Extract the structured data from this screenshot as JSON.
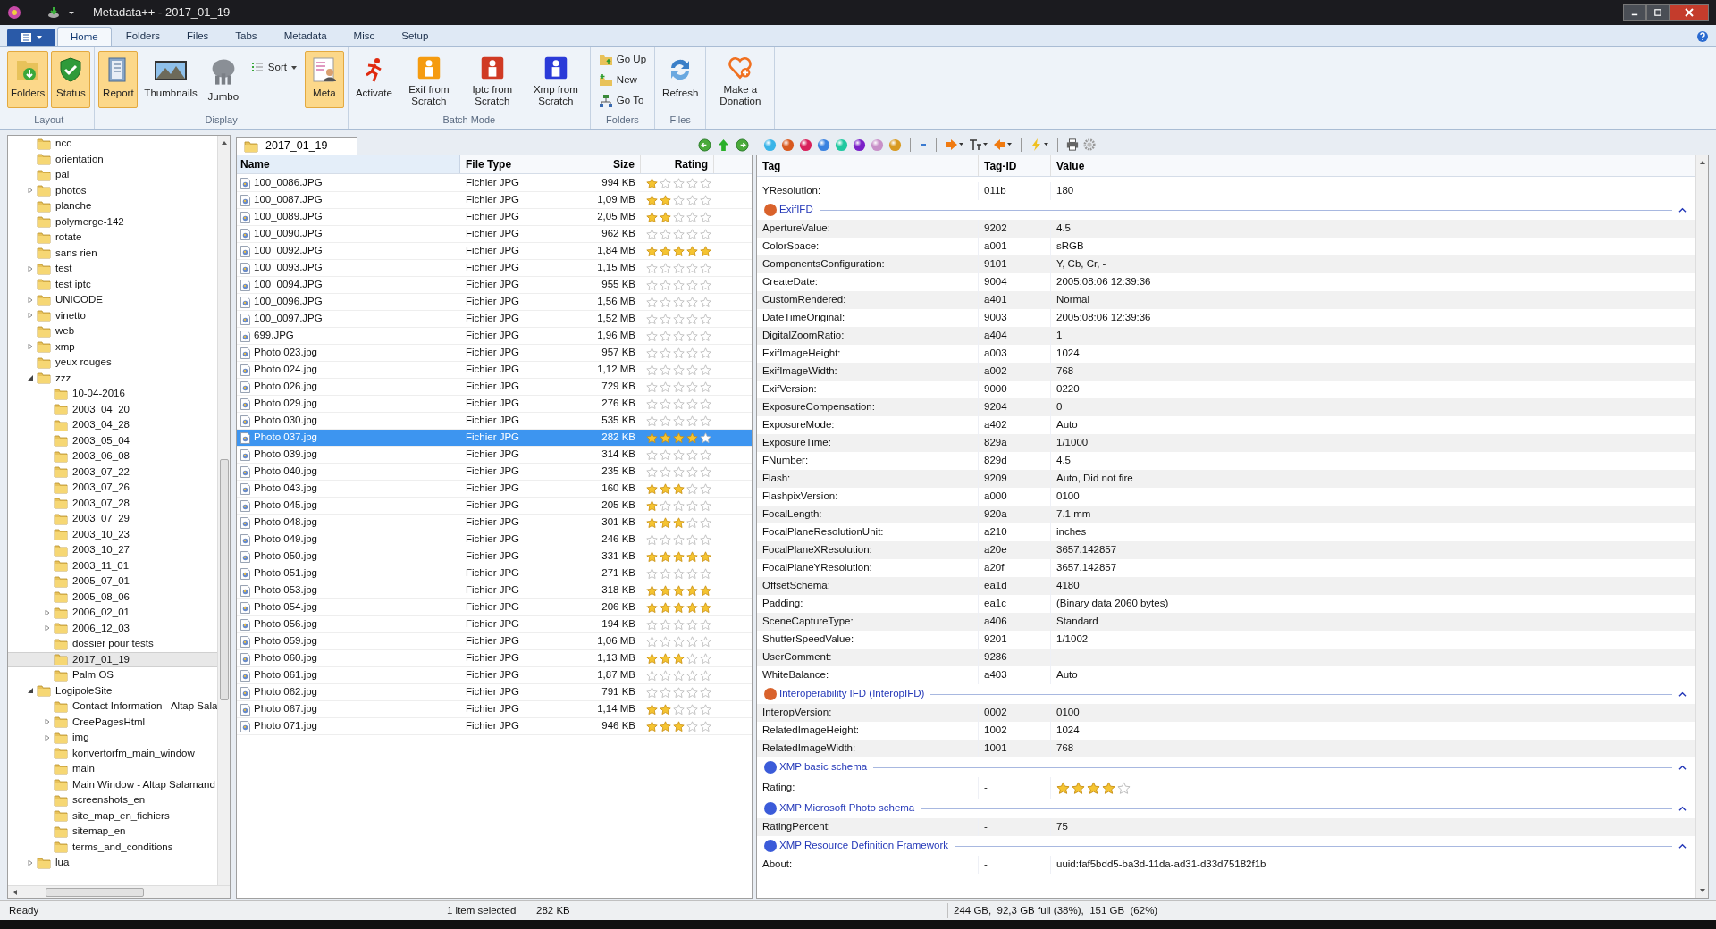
{
  "window": {
    "title": "Metadata++ - 2017_01_19"
  },
  "ribbon_tabs": [
    {
      "label": "Home",
      "selected": true
    },
    {
      "label": "Folders",
      "selected": false
    },
    {
      "label": "Files",
      "selected": false
    },
    {
      "label": "Tabs",
      "selected": false
    },
    {
      "label": "Metadata",
      "selected": false
    },
    {
      "label": "Misc",
      "selected": false
    },
    {
      "label": "Setup",
      "selected": false
    }
  ],
  "ribbon_groups": [
    {
      "label": "Layout",
      "buttons": [
        {
          "kind": "large",
          "label": "Folders",
          "on": true
        },
        {
          "kind": "large",
          "label": "Status",
          "on": true
        }
      ]
    },
    {
      "label": "Display",
      "buttons": [
        {
          "kind": "large",
          "label": "Report",
          "on": true
        },
        {
          "kind": "large",
          "label": "Thumbnails",
          "on": false
        },
        {
          "kind": "large",
          "label": "Jumbo",
          "on": false
        },
        {
          "kind": "menu",
          "label": "Sort",
          "on": false
        },
        {
          "kind": "large",
          "label": "Meta",
          "on": true
        }
      ]
    },
    {
      "label": "Batch Mode",
      "buttons": [
        {
          "kind": "large",
          "label": "Activate",
          "on": false
        },
        {
          "kind": "large",
          "label": "Exif from Scratch",
          "on": false
        },
        {
          "kind": "large",
          "label": "Iptc from Scratch",
          "on": false
        },
        {
          "kind": "large",
          "label": "Xmp from Scratch",
          "on": false
        }
      ]
    },
    {
      "label": "Folders",
      "buttons": [
        {
          "kind": "small",
          "label": "Go Up",
          "on": false
        },
        {
          "kind": "small",
          "label": "New",
          "on": false
        },
        {
          "kind": "small",
          "label": "Go To",
          "on": false
        }
      ]
    },
    {
      "label": "Files",
      "buttons": [
        {
          "kind": "large",
          "label": "Refresh",
          "on": false
        }
      ]
    },
    {
      "buttons": [
        {
          "kind": "large",
          "label": "Make a Donation",
          "on": false
        }
      ]
    }
  ],
  "tree": [
    {
      "children": [
        {
          "label": "ncc",
          "selected": false
        },
        {
          "label": "orientation",
          "selected": false
        },
        {
          "label": "pal",
          "selected": false
        },
        {
          "label": "photos",
          "expanded": false,
          "selected": false
        },
        {
          "label": "planche",
          "selected": false
        },
        {
          "label": "polymerge-142",
          "selected": false
        },
        {
          "label": "rotate",
          "selected": false
        },
        {
          "label": "sans rien",
          "selected": false
        },
        {
          "label": "test",
          "expanded": false,
          "selected": false
        },
        {
          "label": "test iptc",
          "selected": false
        },
        {
          "label": "UNICODE",
          "expanded": false,
          "selected": false
        },
        {
          "label": "vinetto",
          "expanded": false,
          "selected": false
        },
        {
          "label": "web",
          "selected": false
        },
        {
          "label": "xmp",
          "expanded": false,
          "selected": false
        },
        {
          "label": "yeux rouges",
          "selected": false
        },
        {
          "label": "zzz",
          "expanded": true,
          "selected": false,
          "children": [
            {
              "label": "10-04-2016",
              "selected": false
            },
            {
              "label": "2003_04_20",
              "selected": false
            },
            {
              "label": "2003_04_28",
              "selected": false
            },
            {
              "label": "2003_05_04",
              "selected": false
            },
            {
              "label": "2003_06_08",
              "selected": false
            },
            {
              "label": "2003_07_22",
              "selected": false
            },
            {
              "label": "2003_07_26",
              "selected": false
            },
            {
              "label": "2003_07_28",
              "selected": false
            },
            {
              "label": "2003_07_29",
              "selected": false
            },
            {
              "label": "2003_10_23",
              "selected": false
            },
            {
              "label": "2003_10_27",
              "selected": false
            },
            {
              "label": "2003_11_01",
              "selected": false
            },
            {
              "label": "2005_07_01",
              "selected": false
            },
            {
              "label": "2005_08_06",
              "selected": false
            },
            {
              "label": "2006_02_01",
              "expanded": false,
              "selected": false
            },
            {
              "label": "2006_12_03",
              "expanded": false,
              "selected": false
            },
            {
              "label": "dossier pour tests",
              "selected": false
            },
            {
              "label": "2017_01_19",
              "selected": true
            },
            {
              "label": "Palm OS",
              "selected": false
            }
          ]
        }
      ]
    },
    {
      "label": "LogipoleSite",
      "expanded": true,
      "selected": false,
      "children": [
        {
          "label": "Contact Information - Altap Sala",
          "selected": false
        },
        {
          "label": "CreePagesHtml",
          "expanded": false,
          "selected": false
        },
        {
          "label": "img",
          "expanded": false,
          "selected": false
        },
        {
          "label": "konvertorfm_main_window",
          "selected": false
        },
        {
          "label": "main",
          "selected": false
        },
        {
          "label": "Main Window - Altap Salamand",
          "selected": false
        },
        {
          "label": "screenshots_en",
          "selected": false
        },
        {
          "label": "site_map_en_fichiers",
          "selected": false
        },
        {
          "label": "sitemap_en",
          "selected": false
        },
        {
          "label": "terms_and_conditions",
          "selected": false
        }
      ]
    },
    {
      "label": "lua",
      "expanded": false,
      "selected": false
    }
  ],
  "file_tab": {
    "label": "2017_01_19"
  },
  "file_columns": [
    "Name",
    "File Type",
    "Size",
    "Rating"
  ],
  "files": [
    {
      "name": "100_0086.JPG",
      "type": "Fichier JPG",
      "size": "994 KB",
      "stars": 1,
      "selected": false
    },
    {
      "name": "100_0087.JPG",
      "type": "Fichier JPG",
      "size": "1,09 MB",
      "stars": 2,
      "selected": false
    },
    {
      "name": "100_0089.JPG",
      "type": "Fichier JPG",
      "size": "2,05 MB",
      "stars": 2,
      "selected": false
    },
    {
      "name": "100_0090.JPG",
      "type": "Fichier JPG",
      "size": "962 KB",
      "stars": 0,
      "selected": false
    },
    {
      "name": "100_0092.JPG",
      "type": "Fichier JPG",
      "size": "1,84 MB",
      "stars": 5,
      "selected": false
    },
    {
      "name": "100_0093.JPG",
      "type": "Fichier JPG",
      "size": "1,15 MB",
      "stars": 0,
      "selected": false
    },
    {
      "name": "100_0094.JPG",
      "type": "Fichier JPG",
      "size": "955 KB",
      "stars": 0,
      "selected": false
    },
    {
      "name": "100_0096.JPG",
      "type": "Fichier JPG",
      "size": "1,56 MB",
      "stars": 0,
      "selected": false
    },
    {
      "name": "100_0097.JPG",
      "type": "Fichier JPG",
      "size": "1,52 MB",
      "stars": 0,
      "selected": false
    },
    {
      "name": "699.JPG",
      "type": "Fichier JPG",
      "size": "1,96 MB",
      "stars": 0,
      "selected": false
    },
    {
      "name": "Photo 023.jpg",
      "type": "Fichier JPG",
      "size": "957 KB",
      "stars": 0,
      "selected": false
    },
    {
      "name": "Photo 024.jpg",
      "type": "Fichier JPG",
      "size": "1,12 MB",
      "stars": 0,
      "selected": false
    },
    {
      "name": "Photo 026.jpg",
      "type": "Fichier JPG",
      "size": "729 KB",
      "stars": 0,
      "selected": false
    },
    {
      "name": "Photo 029.jpg",
      "type": "Fichier JPG",
      "size": "276 KB",
      "stars": 0,
      "selected": false
    },
    {
      "name": "Photo 030.jpg",
      "type": "Fichier JPG",
      "size": "535 KB",
      "stars": 0,
      "selected": false
    },
    {
      "name": "Photo 037.jpg",
      "type": "Fichier JPG",
      "size": "282 KB",
      "stars": 4,
      "selected": true
    },
    {
      "name": "Photo 039.jpg",
      "type": "Fichier JPG",
      "size": "314 KB",
      "stars": 0,
      "selected": false
    },
    {
      "name": "Photo 040.jpg",
      "type": "Fichier JPG",
      "size": "235 KB",
      "stars": 0,
      "selected": false
    },
    {
      "name": "Photo 043.jpg",
      "type": "Fichier JPG",
      "size": "160 KB",
      "stars": 3,
      "selected": false
    },
    {
      "name": "Photo 045.jpg",
      "type": "Fichier JPG",
      "size": "205 KB",
      "stars": 1,
      "selected": false
    },
    {
      "name": "Photo 048.jpg",
      "type": "Fichier JPG",
      "size": "301 KB",
      "stars": 3,
      "selected": false
    },
    {
      "name": "Photo 049.jpg",
      "type": "Fichier JPG",
      "size": "246 KB",
      "stars": 0,
      "selected": false
    },
    {
      "name": "Photo 050.jpg",
      "type": "Fichier JPG",
      "size": "331 KB",
      "stars": 5,
      "selected": false
    },
    {
      "name": "Photo 051.jpg",
      "type": "Fichier JPG",
      "size": "271 KB",
      "stars": 0,
      "selected": false
    },
    {
      "name": "Photo 053.jpg",
      "type": "Fichier JPG",
      "size": "318 KB",
      "stars": 5,
      "selected": false
    },
    {
      "name": "Photo 054.jpg",
      "type": "Fichier JPG",
      "size": "206 KB",
      "stars": 5,
      "selected": false
    },
    {
      "name": "Photo 056.jpg",
      "type": "Fichier JPG",
      "size": "194 KB",
      "stars": 0,
      "selected": false
    },
    {
      "name": "Photo 059.jpg",
      "type": "Fichier JPG",
      "size": "1,06 MB",
      "stars": 0,
      "selected": false
    },
    {
      "name": "Photo 060.jpg",
      "type": "Fichier JPG",
      "size": "1,13 MB",
      "stars": 3,
      "selected": false
    },
    {
      "name": "Photo 061.jpg",
      "type": "Fichier JPG",
      "size": "1,87 MB",
      "stars": 0,
      "selected": false
    },
    {
      "name": "Photo 062.jpg",
      "type": "Fichier JPG",
      "size": "791 KB",
      "stars": 0,
      "selected": false
    },
    {
      "name": "Photo 067.jpg",
      "type": "Fichier JPG",
      "size": "1,14 MB",
      "stars": 2,
      "selected": false
    },
    {
      "name": "Photo 071.jpg",
      "type": "Fichier JPG",
      "size": "946 KB",
      "stars": 3,
      "selected": false
    }
  ],
  "meta_columns": [
    "Tag",
    "Tag-ID",
    "Value"
  ],
  "meta_rows": [
    {
      "kind": "field",
      "tag": "YResolution:",
      "id": "011b",
      "value": "180"
    },
    {
      "kind": "section",
      "title": "ExifIFD",
      "color": "#d9622b",
      "expanded": true
    },
    {
      "kind": "field",
      "tag": "ApertureValue:",
      "id": "9202",
      "value": "4.5"
    },
    {
      "kind": "field",
      "tag": "ColorSpace:",
      "id": "a001",
      "value": "sRGB"
    },
    {
      "kind": "field",
      "tag": "ComponentsConfiguration:",
      "id": "9101",
      "value": "Y, Cb, Cr, -"
    },
    {
      "kind": "field",
      "tag": "CreateDate:",
      "id": "9004",
      "value": "2005:08:06 12:39:36"
    },
    {
      "kind": "field",
      "tag": "CustomRendered:",
      "id": "a401",
      "value": "Normal"
    },
    {
      "kind": "field",
      "tag": "DateTimeOriginal:",
      "id": "9003",
      "value": "2005:08:06 12:39:36"
    },
    {
      "kind": "field",
      "tag": "DigitalZoomRatio:",
      "id": "a404",
      "value": "1"
    },
    {
      "kind": "field",
      "tag": "ExifImageHeight:",
      "id": "a003",
      "value": "1024"
    },
    {
      "kind": "field",
      "tag": "ExifImageWidth:",
      "id": "a002",
      "value": "768"
    },
    {
      "kind": "field",
      "tag": "ExifVersion:",
      "id": "9000",
      "value": "0220"
    },
    {
      "kind": "field",
      "tag": "ExposureCompensation:",
      "id": "9204",
      "value": "0"
    },
    {
      "kind": "field",
      "tag": "ExposureMode:",
      "id": "a402",
      "value": "Auto"
    },
    {
      "kind": "field",
      "tag": "ExposureTime:",
      "id": "829a",
      "value": "1/1000"
    },
    {
      "kind": "field",
      "tag": "FNumber:",
      "id": "829d",
      "value": "4.5"
    },
    {
      "kind": "field",
      "tag": "Flash:",
      "id": "9209",
      "value": "Auto, Did not fire"
    },
    {
      "kind": "field",
      "tag": "FlashpixVersion:",
      "id": "a000",
      "value": "0100"
    },
    {
      "kind": "field",
      "tag": "FocalLength:",
      "id": "920a",
      "value": "7.1 mm"
    },
    {
      "kind": "field",
      "tag": "FocalPlaneResolutionUnit:",
      "id": "a210",
      "value": "inches"
    },
    {
      "kind": "field",
      "tag": "FocalPlaneXResolution:",
      "id": "a20e",
      "value": "3657.142857"
    },
    {
      "kind": "field",
      "tag": "FocalPlaneYResolution:",
      "id": "a20f",
      "value": "3657.142857"
    },
    {
      "kind": "field",
      "tag": "OffsetSchema:",
      "id": "ea1d",
      "value": "4180"
    },
    {
      "kind": "field",
      "tag": "Padding:",
      "id": "ea1c",
      "value": "(Binary data 2060 bytes)"
    },
    {
      "kind": "field",
      "tag": "SceneCaptureType:",
      "id": "a406",
      "value": "Standard"
    },
    {
      "kind": "field",
      "tag": "ShutterSpeedValue:",
      "id": "9201",
      "value": "1/1002"
    },
    {
      "kind": "field",
      "tag": "UserComment:",
      "id": "9286"
    },
    {
      "kind": "field",
      "tag": "WhiteBalance:",
      "id": "a403",
      "value": "Auto"
    },
    {
      "kind": "section",
      "title": "Interoperability IFD (InteropIFD)",
      "color": "#d9622b",
      "expanded": true
    },
    {
      "kind": "field",
      "tag": "InteropVersion:",
      "id": "0002",
      "value": "0100"
    },
    {
      "kind": "field",
      "tag": "RelatedImageHeight:",
      "id": "1002",
      "value": "1024"
    },
    {
      "kind": "field",
      "tag": "RelatedImageWidth:",
      "id": "1001",
      "value": "768"
    },
    {
      "kind": "section",
      "title": "XMP basic schema",
      "color": "#3b5bd9",
      "expanded": true
    },
    {
      "kind": "rating",
      "tag": "Rating:",
      "id": "-",
      "stars": 4
    },
    {
      "kind": "section",
      "title": "XMP Microsoft Photo schema",
      "color": "#3b5bd9",
      "expanded": true
    },
    {
      "kind": "field",
      "tag": "RatingPercent:",
      "id": "-",
      "value": "75"
    },
    {
      "kind": "section",
      "title": "XMP Resource Definition Framework",
      "color": "#3b5bd9",
      "expanded": true
    },
    {
      "kind": "field",
      "tag": "About:",
      "id": "-",
      "value": "uuid:faf5bdd5-ba3d-11da-ad31-d33d75182f1b"
    }
  ],
  "status_bar": {
    "state": "Ready",
    "selection": "1 item selected",
    "selection_size": "282 KB",
    "disk": "244 GB,  92,3 GB full (38%),  151 GB  (62%)"
  }
}
